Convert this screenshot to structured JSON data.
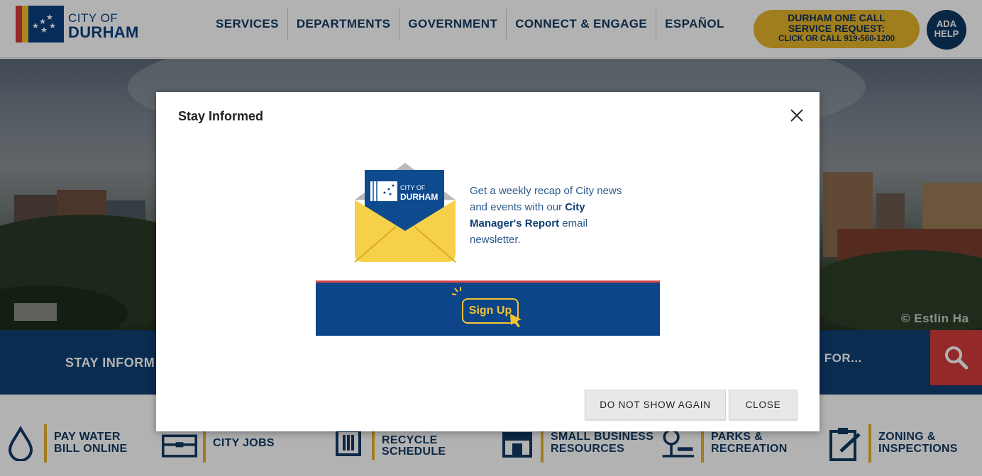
{
  "header": {
    "logo_line1": "CITY OF",
    "logo_line2": "DURHAM",
    "nav": [
      {
        "label": "SERVICES"
      },
      {
        "label": "DEPARTMENTS"
      },
      {
        "label": "GOVERNMENT"
      },
      {
        "label": "CONNECT & ENGAGE"
      },
      {
        "label": "ESPAÑOL"
      }
    ],
    "one_call_line1": "DURHAM ONE CALL",
    "one_call_line2": "SERVICE REQUEST:",
    "one_call_line3": "CLICK OR CALL 919-560-1200",
    "ada_line1": "ADA",
    "ada_line2": "HELP"
  },
  "hero": {
    "credit": "© Estlin Ha"
  },
  "band": {
    "stay_informed": "STAY INFORM",
    "search_placeholder": "NG FOR..."
  },
  "quick_links": [
    {
      "label": "PAY WATER\nBILL ONLINE",
      "icon": "water-drop-icon"
    },
    {
      "label": "CITY JOBS",
      "icon": "briefcase-icon"
    },
    {
      "label": "TRASH /\nRECYCLE\nSCHEDULE",
      "icon": "trash-bin-icon"
    },
    {
      "label": "SMALL BUSINESS\nRESOURCES",
      "icon": "storefront-icon"
    },
    {
      "label": "PARKS &\nRECREATION",
      "icon": "tree-bench-icon"
    },
    {
      "label": "ZONING &\nINSPECTIONS",
      "icon": "clipboard-pencil-icon"
    }
  ],
  "modal": {
    "title": "Stay Informed",
    "envelope_logo_line1": "CITY OF",
    "envelope_logo_line2": "DURHAM",
    "promo_before": "Get a weekly recap of City news and events with our ",
    "promo_highlight": "City Manager's Report",
    "promo_after": " email newsletter.",
    "signup_label": "Sign Up",
    "dont_show_label": "DO NOT SHOW AGAIN",
    "close_label": "CLOSE"
  },
  "colors": {
    "brand_blue": "#0f3f73",
    "accent_yellow": "#e5b32a",
    "accent_red": "#d33b3b"
  }
}
